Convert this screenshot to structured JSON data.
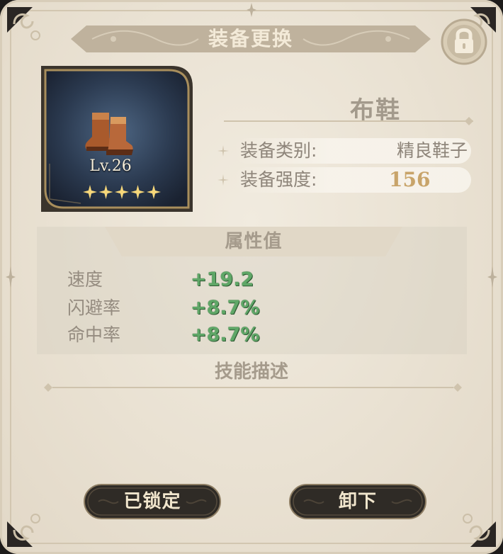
{
  "header": {
    "title": "装备更换"
  },
  "item": {
    "name": "布鞋",
    "level": "Lv.26",
    "stars": 5,
    "icon": "boots-icon",
    "category_label": "装备类别:",
    "category_value": "精良鞋子",
    "power_label": "装备强度:",
    "power_value": "156"
  },
  "attributes": {
    "title": "属性值",
    "rows": [
      {
        "name": "速度",
        "value": "+19.2"
      },
      {
        "name": "闪避率",
        "value": "+8.7%"
      },
      {
        "name": "命中率",
        "value": "+8.7%"
      }
    ]
  },
  "skill": {
    "title": "技能描述"
  },
  "buttons": {
    "locked_label": "已锁定",
    "unequip_label": "卸下"
  },
  "colors": {
    "accent_gold": "#c8a46a",
    "stat_green": "#5fa767",
    "button_dark": "#2f2b26",
    "title_bar": "#bfb29d"
  }
}
